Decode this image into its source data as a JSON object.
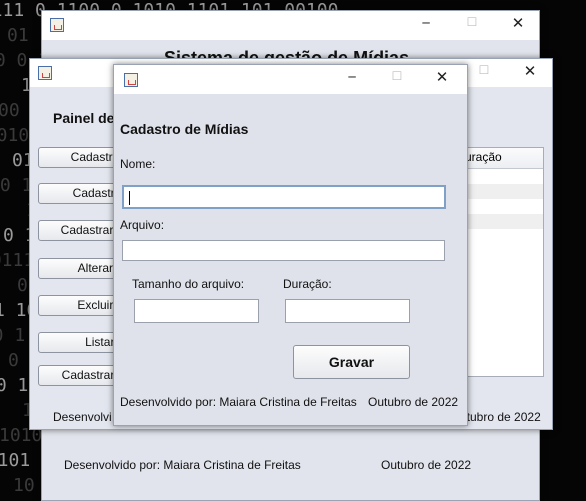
{
  "background": {
    "rows": [
      "10111 0 1100 0 1010 1101 101 00100",
      "01 1 00 1 011 0 11 1001 0 1 11 01011",
      "10 0 1 10 10 11 0 1011 1 00 10 1101",
      "1110 1 0 0110 0 1 10 1 0101 1 00 101",
      "00 1 10 1101 0 1 0 11 0 1 1101 1 001",
      "1 0101 1 00 1 10 1011 0 1 10 1 0110",
      "0110 1 0 11 0101 1 0 110 1 01 1 1010",
      "10 1 0010 1 10 1 0 1101 0 1 10 01 11",
      "1101 0 10 1 011 0 1 1 0010 1 01 1 0",
      "0 1 1101 0 10 1 0 1011 0 1 10 1 0101",
      "10111 0 1 0 1101 1 0 1 0 0101 1 11",
      "0 10 1 0110 1 0 1 1101 0 1 10 1 011",
      "1 10 1011 0 1 0101 1 0 1 10 1 1100",
      "100 1 01 1 0 11 0 1 1010 1 01 0 1011",
      "0 1 10 1 0011 1 0 1 1 1010 0 1 10 1",
      "10 1 100 1 0 1 1101 0 1 10 1 00 1 0",
      "10 01 10 1 0 1 10 1 1010 1 10 1 001",
      "1010 1 100 1 0 1 10 1010111010 1 10",
      "10101 0 1001 1 0 1 10 1 0 1000101",
      "10 01 1 0 1 10 1 0 1 10 1 0 1 1010"
    ]
  },
  "win_back": {
    "title": "Sistema de gestão de Mídias",
    "footer_author": "Desenvolvido por: Maiara Cristina de Freitas",
    "footer_date": "Outubro de 2022"
  },
  "win_middle": {
    "panel_title": "Painel de",
    "buttons": [
      "Cadastrar",
      "Cadastrar",
      "Cadastrar U",
      "Alterar M",
      "Excluir M",
      "Listar T",
      "Cadastrar C"
    ],
    "table_header_partial": "uração",
    "footer_author_partial": "Desenvolvi",
    "footer_date_partial": "utubro de 2022"
  },
  "dialog": {
    "heading": "Cadastro de Mídias",
    "name_label": "Nome:",
    "name_value": "",
    "file_label": "Arquivo:",
    "file_value": "",
    "size_label": "Tamanho do arquivo:",
    "size_value": "",
    "duration_label": "Duração:",
    "duration_value": "",
    "save_button": "Gravar",
    "footer_author": "Desenvolvido por: Maiara Cristina de Freitas",
    "footer_date": "Outubro de 2022"
  },
  "titlebar_icons": {
    "minimize": "minimize-icon",
    "maximize": "maximize-icon",
    "close": "close-icon",
    "app": "java-app-icon"
  }
}
